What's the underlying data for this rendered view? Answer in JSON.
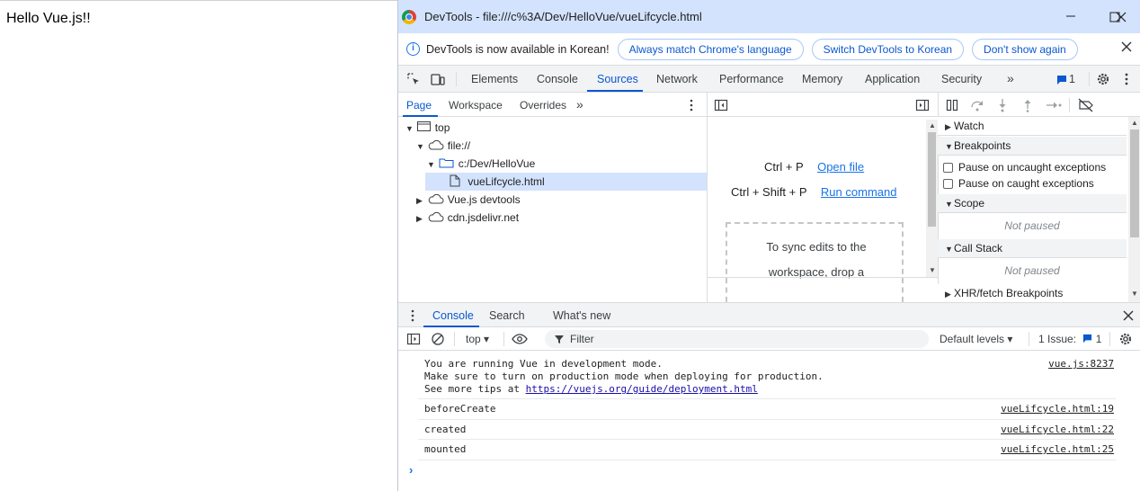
{
  "page": {
    "heading": "Hello Vue.js!!"
  },
  "window": {
    "title": "DevTools - file:///c%3A/Dev/HelloVue/vueLifcycle.html"
  },
  "infobar": {
    "message": "DevTools is now available in Korean!",
    "btn_match": "Always match Chrome's language",
    "btn_switch": "Switch DevTools to Korean",
    "btn_dont_show": "Don't show again"
  },
  "main_tabs": [
    "Elements",
    "Console",
    "Sources",
    "Network",
    "Performance",
    "Memory",
    "Application",
    "Security"
  ],
  "issues_badge": "1",
  "navigator": {
    "tabs": [
      "Page",
      "Workspace",
      "Overrides"
    ],
    "tree": {
      "top": "top",
      "file": "file://",
      "folder": "c:/Dev/HelloVue",
      "selected_file": "vueLifcycle.html",
      "devtools": "Vue.js devtools",
      "cdn": "cdn.jsdelivr.net"
    }
  },
  "editor": {
    "shortcut1_keys": "Ctrl + P",
    "shortcut1_label": "Open file",
    "shortcut2_keys": "Ctrl + Shift + P",
    "shortcut2_label": "Run command",
    "drop_line1": "To sync edits to the",
    "drop_line2": "workspace, drop a"
  },
  "debugger": {
    "watch": "Watch",
    "breakpoints": "Breakpoints",
    "pause_uncaught": "Pause on uncaught exceptions",
    "pause_caught": "Pause on caught exceptions",
    "scope": "Scope",
    "not_paused": "Not paused",
    "call_stack": "Call Stack",
    "xhr": "XHR/fetch Breakpoints"
  },
  "drawer": {
    "tabs": [
      "Console",
      "Search",
      "What's new"
    ]
  },
  "console_toolbar": {
    "context": "top",
    "filter_placeholder": "Filter",
    "levels": "Default levels",
    "issues_label": "1 Issue:",
    "issues_count": "1"
  },
  "console": {
    "vue_line1": "You are running Vue in development mode.",
    "vue_line2": "Make sure to turn on production mode when deploying for production.",
    "vue_line3_prefix": "See more tips at ",
    "vue_line3_link": "https://vuejs.org/guide/deployment.html",
    "vue_source": "vue.js:8237",
    "msg_before_create": "beforeCreate",
    "src_before_create": "vueLifcycle.html:19",
    "msg_created": "created",
    "src_created": "vueLifcycle.html:22",
    "msg_mounted": "mounted",
    "src_mounted": "vueLifcycle.html:25"
  }
}
